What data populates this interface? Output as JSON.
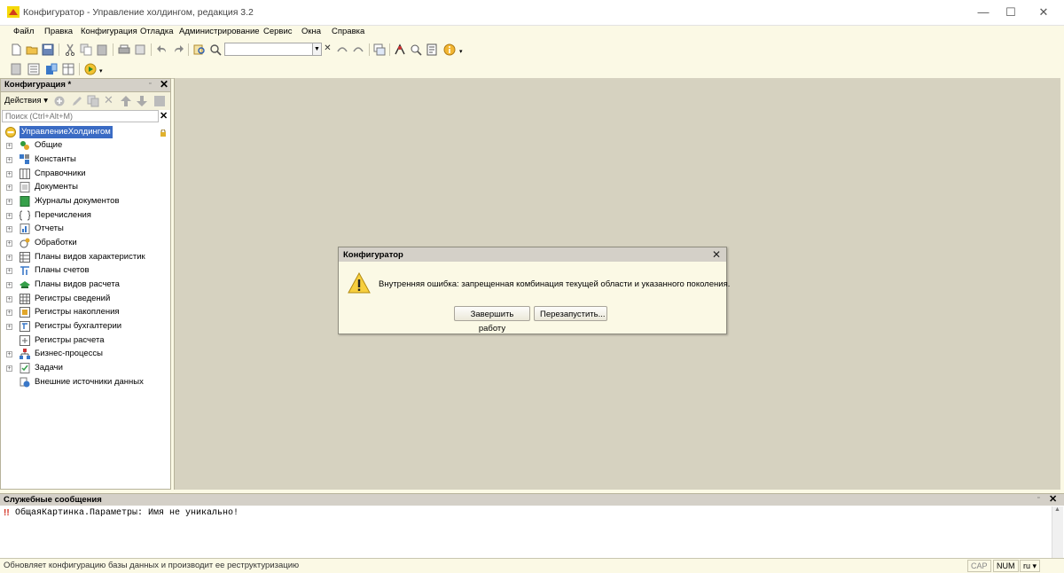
{
  "window": {
    "title": "Конфигуратор - Управление холдингом, редакция 3.2",
    "minimize_glyph": "—",
    "maximize_glyph": "☐",
    "close_glyph": "✕"
  },
  "menu": [
    "Файл",
    "Правка",
    "Конфигурация",
    "Отладка",
    "Администрирование",
    "Сервис",
    "Окна",
    "Справка"
  ],
  "config_panel": {
    "title": "Конфигурация *",
    "actions_label": "Действия ▾",
    "search_placeholder": "Поиск (Ctrl+Alt+M)",
    "root": "УправлениеХолдингом",
    "items": [
      "Общие",
      "Константы",
      "Справочники",
      "Документы",
      "Журналы документов",
      "Перечисления",
      "Отчеты",
      "Обработки",
      "Планы видов характеристик",
      "Планы счетов",
      "Планы видов расчета",
      "Регистры сведений",
      "Регистры накопления",
      "Регистры бухгалтерии",
      "Регистры расчета",
      "Бизнес-процессы",
      "Задачи",
      "Внешние источники данных"
    ]
  },
  "dialog": {
    "title": "Конфигуратор",
    "message": "Внутренняя ошибка: запрещенная комбинация текущей области и указанного поколения.",
    "btn_finish": "Завершить работу",
    "btn_restart": "Перезапустить..."
  },
  "messages": {
    "title": "Служебные сообщения",
    "line": "ОбщаяКартинка.Параметры: Имя не уникально!"
  },
  "status": {
    "text": "Обновляет конфигурацию базы данных и производит ее реструктуризацию",
    "cap": "CAP",
    "num": "NUM",
    "lang": "ru ▾"
  }
}
